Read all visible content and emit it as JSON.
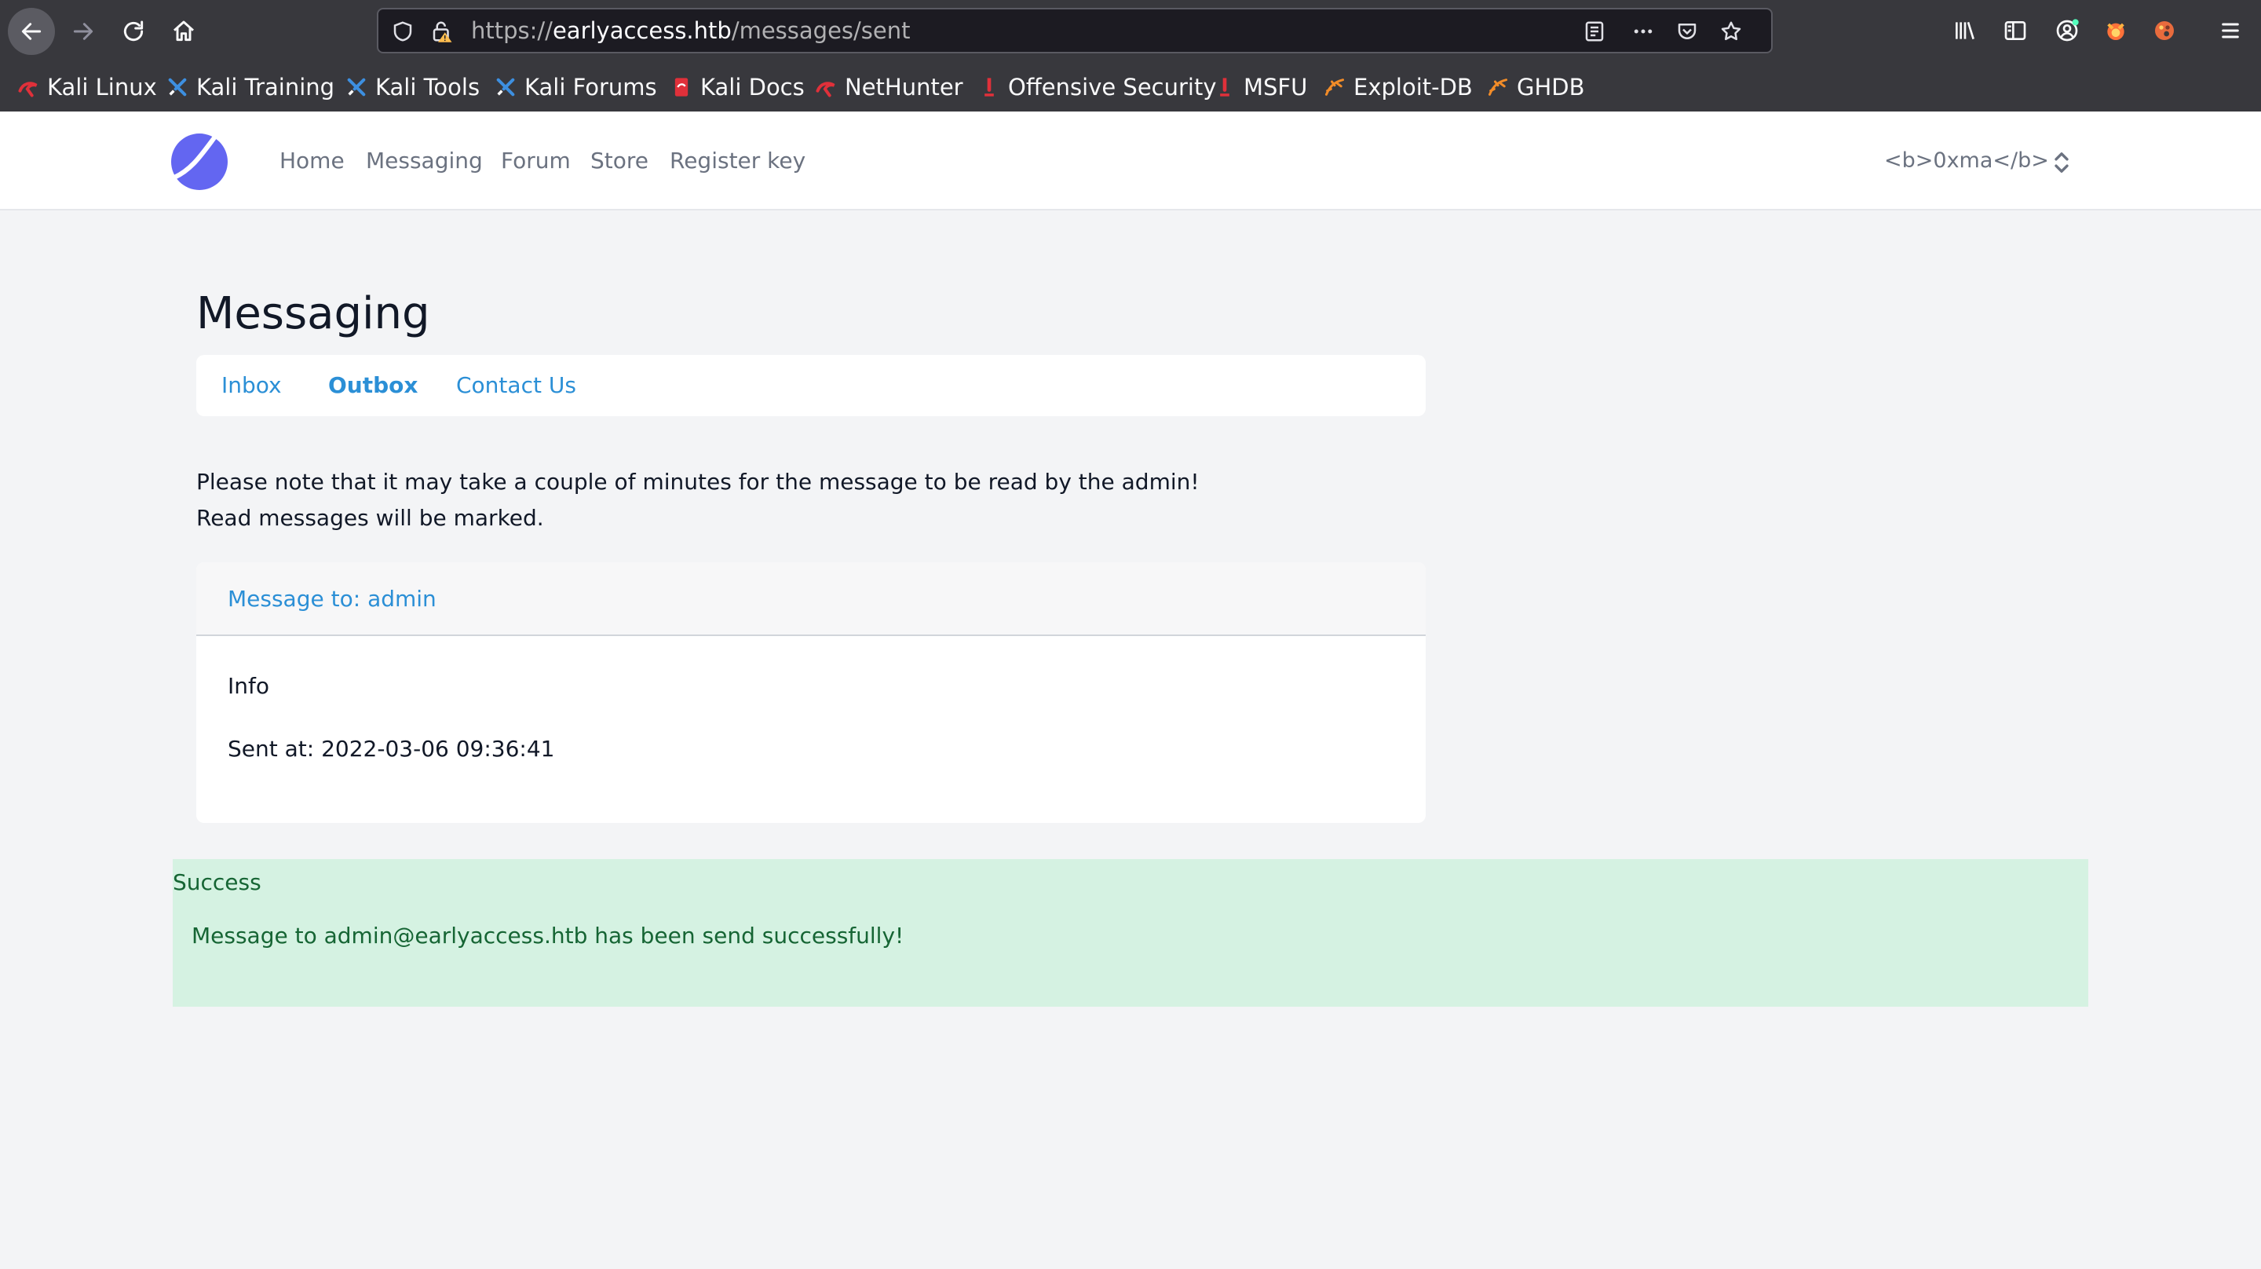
{
  "browser": {
    "url_scheme": "https://",
    "url_host": "earlyaccess.htb",
    "url_path": "/messages/sent",
    "bookmarks": [
      {
        "label": "Kali Linux",
        "icon": "kali-dragon-icon"
      },
      {
        "label": "Kali Training",
        "icon": "kali-training-icon"
      },
      {
        "label": "Kali Tools",
        "icon": "kali-tools-icon"
      },
      {
        "label": "Kali Forums",
        "icon": "kali-forums-icon"
      },
      {
        "label": "Kali Docs",
        "icon": "kali-docs-icon"
      },
      {
        "label": "NetHunter",
        "icon": "nethunter-icon"
      },
      {
        "label": "Offensive Security",
        "icon": "offsec-icon"
      },
      {
        "label": "MSFU",
        "icon": "msfu-icon"
      },
      {
        "label": "Exploit-DB",
        "icon": "exploit-db-icon"
      },
      {
        "label": "GHDB",
        "icon": "ghdb-icon"
      }
    ]
  },
  "nav": {
    "links": [
      "Home",
      "Messaging",
      "Forum",
      "Store",
      "Register key"
    ],
    "user": "<b>0xma</b>"
  },
  "page": {
    "title": "Messaging",
    "tabs": [
      {
        "label": "Inbox",
        "active": false
      },
      {
        "label": "Outbox",
        "active": true
      },
      {
        "label": "Contact Us",
        "active": false
      }
    ],
    "note_line1": "Please note that it may take a couple of minutes for the message to be read by the admin!",
    "note_line2": "Read messages will be marked."
  },
  "message": {
    "to": "Message to: admin",
    "subject": "Info",
    "sent_at": "Sent at: 2022-03-06 09:36:41"
  },
  "alert": {
    "title": "Success",
    "text": "Message to admin@earlyaccess.htb has been send successfully!"
  },
  "colors": {
    "link": "#2b8fd6",
    "success_bg": "#d5f2e2",
    "success_text": "#166534",
    "page_bg": "#f3f4f6",
    "logo": "#6366f1"
  }
}
